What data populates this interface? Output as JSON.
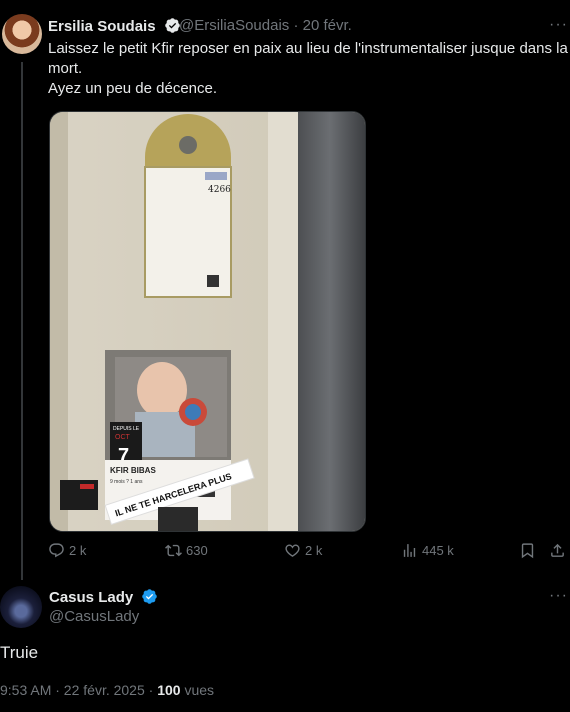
{
  "tweet": {
    "author_name": "Ersilia Soudais",
    "handle_date": "@ErsiliaSoudais · 20 févr.",
    "text_line1": "Laissez le petit Kfir reposer en paix au lieu de l'instrumentaliser jusque dans la mort.",
    "text_line2": "Ayez un peu de décence.",
    "more": "···",
    "image": {
      "tag_number": "4266",
      "poster_month": "OCT",
      "poster_day": "7",
      "poster_top": "DEPUIS LE",
      "poster_name": "KFIR BIBAS",
      "poster_age": "9 mois ? 1 ans",
      "banner": "IL NE TE HARCELERA PLUS"
    },
    "stats": {
      "replies": "2 k",
      "reposts": "630",
      "likes": "2 k",
      "views": "445 k"
    }
  },
  "reply": {
    "author_name": "Casus Lady",
    "handle": "@CasusLady",
    "more": "···",
    "text": "Truie",
    "time_date": "9:53 AM · 22 févr. 2025 · ",
    "views_count": "100",
    "views_label": " vues"
  },
  "colors": {
    "background": "#000000",
    "text": "#e7e9ea",
    "muted": "#71767b",
    "verified": "#1d9bf0"
  }
}
